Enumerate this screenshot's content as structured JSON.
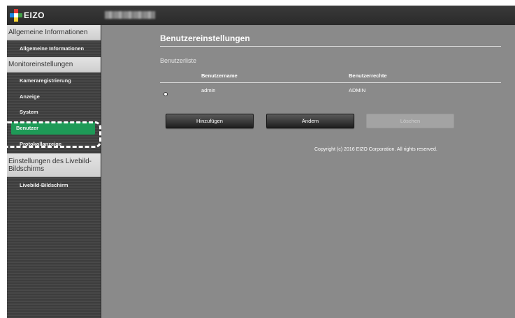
{
  "app": {
    "brand": "EIZO",
    "device_name": ""
  },
  "sidebar": {
    "sections": [
      {
        "label": "Allgemeine Informationen",
        "items": [
          {
            "label": "Allgemeine Informationen"
          }
        ]
      },
      {
        "label": "Monitoreinstellungen",
        "items": [
          {
            "label": "Kameraregistrierung"
          },
          {
            "label": "Anzeige"
          },
          {
            "label": "System"
          },
          {
            "label": "Benutzer",
            "active": true
          },
          {
            "label": "Protokollanzeige"
          }
        ]
      },
      {
        "label": "Einstellungen des Livebild-Bildschirms",
        "items": [
          {
            "label": "Livebild-Bildschirm"
          }
        ]
      }
    ]
  },
  "main": {
    "title": "Benutzereinstellungen",
    "list_label": "Benutzerliste",
    "columns": [
      "Benutzername",
      "Benutzerrechte"
    ],
    "rows": [
      {
        "name": "admin",
        "rights": "ADMIN",
        "selected": true
      }
    ],
    "buttons": {
      "add": "Hinzufügen",
      "edit": "Ändern",
      "delete": "Löschen"
    },
    "copyright": "Copyright (c) 2016 EIZO Corporation. All rights reserved."
  },
  "colors": {
    "active_item": "#1e9a57",
    "highlight": "#ffffff"
  }
}
